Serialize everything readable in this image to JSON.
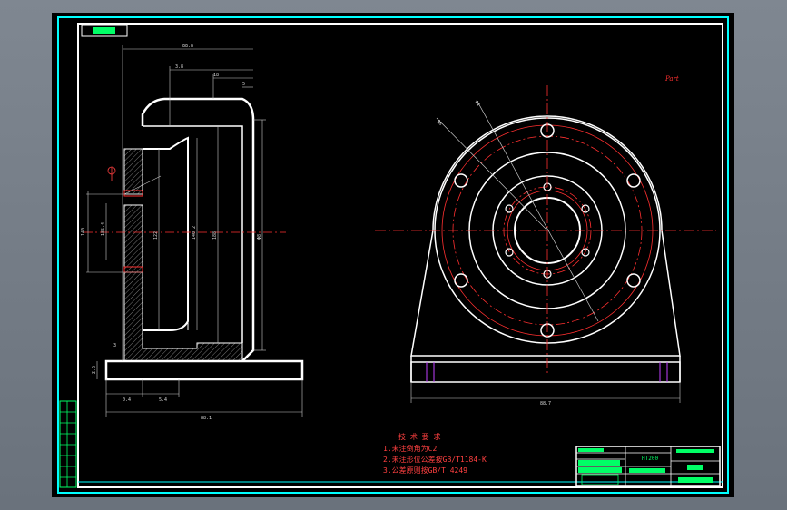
{
  "colors": {
    "app_background": "#747c86",
    "drawing_background": "#000000",
    "outline": "#ffffff",
    "frame": "#00ffff",
    "dimension": "#c8c8c8",
    "centerline": "#ff3030",
    "annotation": "#ff4040",
    "title_block": "#00ff66",
    "hidden_line": "#c040ff"
  },
  "icons": [
    "view-symbol-icon"
  ],
  "technical_requirements": {
    "title": "技 术 要 求",
    "items": [
      "1.未注倒角为C2",
      "2.未注形位公差按GB/T1184-K",
      "3.公差原则按GB/T 4249"
    ]
  },
  "title_block": {
    "material": "HT200",
    "part_name": "Part",
    "scale": "1:1"
  },
  "stamp_text": "Part",
  "side_view": {
    "dimensions": [
      "88.8",
      "3.8",
      "18",
      "5",
      "140",
      "185.4",
      "122",
      "140.2",
      "188",
      "Φ8",
      "0.4",
      "5.4",
      "88.1",
      "3",
      "2.6"
    ]
  },
  "front_view": {
    "dimensions": [
      "Φ8",
      "Φ4",
      "88.7"
    ]
  }
}
